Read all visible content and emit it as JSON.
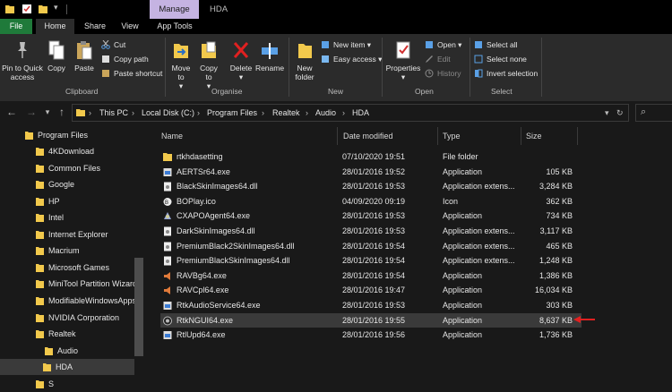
{
  "window": {
    "title": "HDA",
    "context_tab": "Manage"
  },
  "tabs": [
    "File",
    "Home",
    "Share",
    "View",
    "App Tools"
  ],
  "ribbon": {
    "clipboard": {
      "pin": "Pin to Quick access",
      "copy": "Copy",
      "paste": "Paste",
      "cut": "Cut",
      "copy_path": "Copy path",
      "paste_shortcut": "Paste shortcut",
      "label": "Clipboard"
    },
    "organise": {
      "move_to": "Move to",
      "copy_to": "Copy to",
      "delete": "Delete",
      "rename": "Rename",
      "label": "Organise"
    },
    "new": {
      "new_folder": "New folder",
      "new_item": "New item",
      "easy_access": "Easy access",
      "label": "New"
    },
    "open": {
      "properties": "Properties",
      "open": "Open",
      "edit": "Edit",
      "history": "History",
      "label": "Open"
    },
    "select": {
      "select_all": "Select all",
      "select_none": "Select none",
      "invert": "Invert selection",
      "label": "Select"
    }
  },
  "address": {
    "crumbs": [
      "This PC",
      "Local Disk (C:)",
      "Program Files",
      "Realtek",
      "Audio",
      "HDA"
    ]
  },
  "nav": {
    "items": [
      "Program Files",
      "4KDownload",
      "Common Files",
      "Google",
      "HP",
      "Intel",
      "Internet Explorer",
      "Macrium",
      "Microsoft Games",
      "MiniTool Partition Wizard",
      "ModifiableWindowsApps",
      "NVIDIA Corporation",
      "Realtek",
      "Audio",
      "HDA",
      "S"
    ]
  },
  "columns": {
    "name": "Name",
    "date": "Date modified",
    "type": "Type",
    "size": "Size"
  },
  "files": [
    {
      "name": "rtkhdasetting",
      "date": "07/10/2020 19:51",
      "type": "File folder",
      "size": "",
      "icon": "folder-icon"
    },
    {
      "name": "AERTSr64.exe",
      "date": "28/01/2016 19:52",
      "type": "Application",
      "size": "105 KB",
      "icon": "app-icon"
    },
    {
      "name": "BlackSkinImages64.dll",
      "date": "28/01/2016 19:53",
      "type": "Application extens...",
      "size": "3,284 KB",
      "icon": "dll-icon"
    },
    {
      "name": "BOPlay.ico",
      "date": "04/09/2020 09:19",
      "type": "Icon",
      "size": "362 KB",
      "icon": "ico-icon"
    },
    {
      "name": "CXAPOAgent64.exe",
      "date": "28/01/2016 19:53",
      "type": "Application",
      "size": "734 KB",
      "icon": "agent-icon"
    },
    {
      "name": "DarkSkinImages64.dll",
      "date": "28/01/2016 19:53",
      "type": "Application extens...",
      "size": "3,117 KB",
      "icon": "dll-icon"
    },
    {
      "name": "PremiumBlack2SkinImages64.dll",
      "date": "28/01/2016 19:54",
      "type": "Application extens...",
      "size": "465 KB",
      "icon": "dll-icon"
    },
    {
      "name": "PremiumBlackSkinImages64.dll",
      "date": "28/01/2016 19:54",
      "type": "Application extens...",
      "size": "1,248 KB",
      "icon": "dll-icon"
    },
    {
      "name": "RAVBg64.exe",
      "date": "28/01/2016 19:54",
      "type": "Application",
      "size": "1,386 KB",
      "icon": "speaker-icon"
    },
    {
      "name": "RAVCpl64.exe",
      "date": "28/01/2016 19:47",
      "type": "Application",
      "size": "16,034 KB",
      "icon": "speaker-icon"
    },
    {
      "name": "RtkAudioService64.exe",
      "date": "28/01/2016 19:53",
      "type": "Application",
      "size": "303 KB",
      "icon": "app-icon"
    },
    {
      "name": "RtkNGUI64.exe",
      "date": "28/01/2016 19:55",
      "type": "Application",
      "size": "8,637 KB",
      "icon": "gui-icon"
    },
    {
      "name": "RtlUpd64.exe",
      "date": "28/01/2016 19:56",
      "type": "Application",
      "size": "1,736 KB",
      "icon": "app-icon"
    }
  ],
  "colors": {
    "file_tab": "#1f7a3a",
    "manage_tab": "#c5b3e2",
    "selection": "#3a3a3a",
    "arrow": "#e02020",
    "folder": "#f2c94c"
  }
}
